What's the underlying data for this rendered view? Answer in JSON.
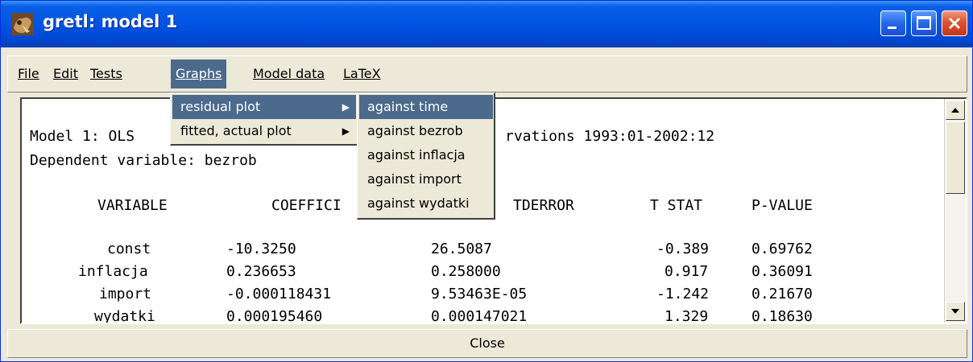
{
  "window": {
    "title": "gretl: model 1"
  },
  "menubar": {
    "file": "File",
    "edit": "Edit",
    "tests": "Tests",
    "graphs": "Graphs",
    "model_data": "Model data",
    "latex": "LaTeX"
  },
  "graphs_menu": {
    "items": [
      "residual plot",
      "fitted, actual plot"
    ],
    "submenu": [
      "against time",
      "against bezrob",
      "against inflacja",
      "against import",
      "against wydatki"
    ]
  },
  "output": {
    "line1_left": "Model 1: OLS",
    "line1_right": "rvations 1993:01-2002:12",
    "line2": "Dependent variable: bezrob",
    "headers": {
      "variable": "VARIABLE",
      "coefficient": "COEFFICI",
      "stderror": "TDERROR",
      "tstat": "T STAT",
      "pvalue": "P-VALUE"
    },
    "rows": [
      {
        "variable": "const",
        "coef": "-10.3250",
        "stderr": "26.5087",
        "tstat": "-0.389",
        "pvalue": "0.69762"
      },
      {
        "variable": "inflacja",
        "coef": "0.236653",
        "stderr": "0.258000",
        "tstat": "0.917",
        "pvalue": "0.36091"
      },
      {
        "variable": "import",
        "coef": "-0.000118431",
        "stderr": "9.53463E-05",
        "tstat": "-1.242",
        "pvalue": "0.21670"
      },
      {
        "variable": "wydatki",
        "coef": "0.000195460",
        "stderr": "0.000147021",
        "tstat": "1.329",
        "pvalue": "0.18630"
      }
    ]
  },
  "close_button": "Close",
  "colors": {
    "menu_highlight": "#4b6a8c",
    "titlebar": "#0054e3"
  }
}
